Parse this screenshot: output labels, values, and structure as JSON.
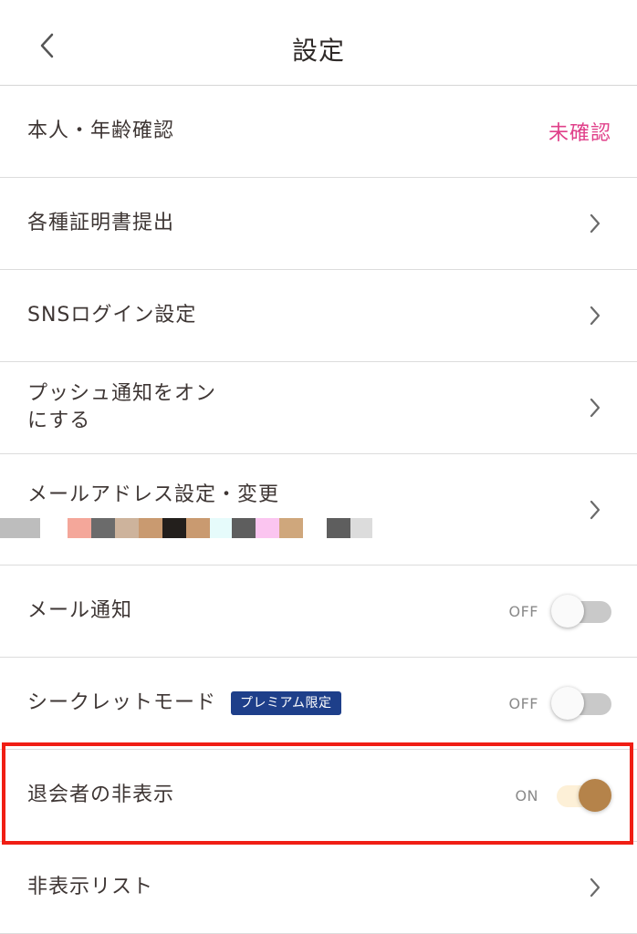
{
  "header": {
    "title": "設定",
    "back_icon": "chevron-left-icon"
  },
  "rows": {
    "identity": {
      "label": "本人・年齢確認",
      "status": "未確認",
      "status_color": "#e0408a"
    },
    "certificates": {
      "label": "各種証明書提出"
    },
    "sns_login": {
      "label": "SNSログイン設定"
    },
    "push": {
      "label_line1": "プッシュ通知をオン",
      "label_line2": "にする"
    },
    "email": {
      "label": "メールアドレス設定・変更",
      "censor_colors": [
        "#bdbdbd",
        "#ffffff",
        "#f4a79a",
        "#6b6b6b",
        "#cdb39c",
        "#c99a70",
        "#231f1c",
        "#c99a70",
        "#e6fbfb",
        "#5e5e5e",
        "#fbc5f0",
        "#cfa77c",
        "#ffffff",
        "#5e5e5e",
        "#dcdcdc"
      ]
    },
    "mail_notify": {
      "label": "メール通知",
      "toggle_text": "OFF",
      "on": false
    },
    "secret_mode": {
      "label": "シークレットモード",
      "badge": "プレミアム限定",
      "badge_color": "#1e3f8a",
      "toggle_text": "OFF",
      "on": false
    },
    "hide_withdrawn": {
      "label": "退会者の非表示",
      "toggle_text": "ON",
      "on": true,
      "highlight_color": "#f01e14"
    },
    "hidden_list": {
      "label": "非表示リスト"
    }
  },
  "colors": {
    "toggle_on_knob": "#b5834a",
    "toggle_on_track": "#fdf0d7",
    "toggle_off_track": "#c9c9c9"
  }
}
